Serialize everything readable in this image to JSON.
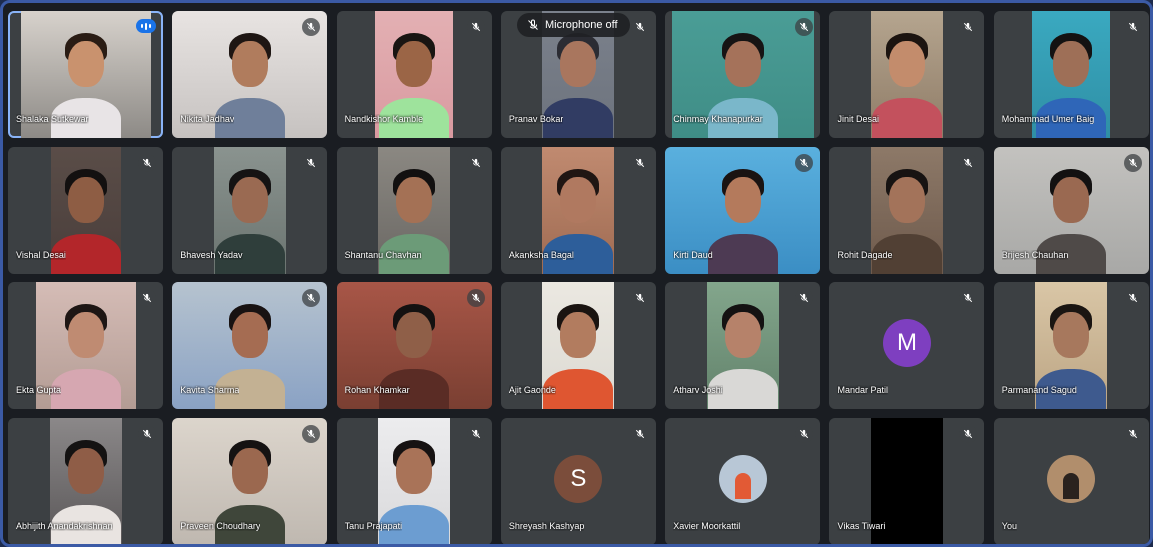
{
  "meeting": {
    "tooltip": {
      "label": "Microphone off",
      "icon": "mic-off-icon"
    },
    "accent_color": "#1a73e8",
    "participants": [
      {
        "name": "Shalaka Sutkewar",
        "status": "speaking",
        "tile": "video",
        "bg": "#8d8a86",
        "skin": "#c9926e",
        "hair": "#2a1c14",
        "shirt": "#e8e4e6",
        "video_bg": "#d7d2cc"
      },
      {
        "name": "Nikita Jadhav",
        "status": "muted",
        "tile": "video",
        "bg": "#c6c2c0",
        "skin": "#b07c5d",
        "hair": "#1e1613",
        "shirt": "#6f7f9a",
        "video_bg": "#e8e4e2"
      },
      {
        "name": "Nandkishor Kamble",
        "status": "muted",
        "tile": "video",
        "bg": "#d99aa0",
        "skin": "#9b6546",
        "hair": "#191512",
        "shirt": "#9ee39c",
        "video_bg": "#e3b0b3"
      },
      {
        "name": "Pranav Bokar",
        "status": "muted",
        "tile": "video",
        "bg": "#6d737d",
        "skin": "#a9765e",
        "hair": "#2b2c33",
        "shirt": "#313c63",
        "video_bg": "#7b818c"
      },
      {
        "name": "Chinmay Khanapurkar",
        "status": "muted",
        "tile": "video",
        "bg": "#3f8d86",
        "skin": "#a5725a",
        "hair": "#161414",
        "shirt": "#7ab7ca",
        "video_bg": "#4a9d96"
      },
      {
        "name": "Jinit Desai",
        "status": "muted",
        "tile": "video",
        "bg": "#8f7c67",
        "skin": "#c38c6c",
        "hair": "#1c1410",
        "shirt": "#c3515d",
        "video_bg": "#b5a58f"
      },
      {
        "name": "Mohammad Umer Baig",
        "status": "muted",
        "tile": "video",
        "bg": "#2f8fa5",
        "skin": "#9e6f57",
        "hair": "#141212",
        "shirt": "#2f66b8",
        "video_bg": "#3aa9c0"
      },
      {
        "name": "Vishal Desai",
        "status": "muted",
        "tile": "video",
        "bg": "#4a3e3b",
        "skin": "#8e5d44",
        "hair": "#131010",
        "shirt": "#b3262a",
        "video_bg": "#5a4d48"
      },
      {
        "name": "Bhavesh Yadav",
        "status": "muted",
        "tile": "video",
        "bg": "#6b7470",
        "skin": "#9a6a52",
        "hair": "#151313",
        "shirt": "#2f3e3b",
        "video_bg": "#8a938f"
      },
      {
        "name": "Shantanu Chavhan",
        "status": "muted",
        "tile": "video",
        "bg": "#6a6763",
        "skin": "#a47155",
        "hair": "#121010",
        "shirt": "#6c9b78",
        "video_bg": "#8b8882"
      },
      {
        "name": "Akanksha Bagal",
        "status": "muted",
        "tile": "video",
        "bg": "#9f6b52",
        "skin": "#b07960",
        "hair": "#201613",
        "shirt": "#2d5e9a",
        "video_bg": "#c08a70"
      },
      {
        "name": "Kirti Daud",
        "status": "muted",
        "tile": "video",
        "bg": "#3b8ec4",
        "skin": "#b47a5c",
        "hair": "#1a1312",
        "shirt": "#4d3a53",
        "video_bg": "#5ab0de"
      },
      {
        "name": "Rohit Dagade",
        "status": "muted",
        "tile": "video",
        "bg": "#6e5a4c",
        "skin": "#a3735a",
        "hair": "#171312",
        "shirt": "#514034",
        "video_bg": "#8d7968"
      },
      {
        "name": "Brijesh Chauhan",
        "status": "muted",
        "tile": "video",
        "bg": "#a8a8a6",
        "skin": "#9a6951",
        "hair": "#131111",
        "shirt": "#4f4a48",
        "video_bg": "#c3c2bf"
      },
      {
        "name": "Ekta Gupta",
        "status": "muted",
        "tile": "video",
        "bg": "#b39c94",
        "skin": "#bf8b72",
        "hair": "#1e1614",
        "shirt": "#d6a7b1",
        "video_bg": "#d5bcb6"
      },
      {
        "name": "Kavita Sharma",
        "status": "muted",
        "tile": "video",
        "bg": "#8aa2c4",
        "skin": "#a56c52",
        "hair": "#181212",
        "shirt": "#c3b193",
        "video_bg": "#b6c3cf"
      },
      {
        "name": "Rohan Khamkar",
        "status": "muted",
        "tile": "video",
        "bg": "#7a3f32",
        "skin": "#8f5f48",
        "hair": "#141111",
        "shirt": "#5a2c25",
        "video_bg": "#a85647"
      },
      {
        "name": "Ajit Gaonde",
        "status": "muted",
        "tile": "video",
        "bg": "#dcdad3",
        "skin": "#b27c5f",
        "hair": "#1a1411",
        "shirt": "#df5631",
        "video_bg": "#ebe8e1"
      },
      {
        "name": "Atharv Joshi",
        "status": "muted",
        "tile": "video",
        "bg": "#62826b",
        "skin": "#b6826a",
        "hair": "#141212",
        "shirt": "#d9d8d6",
        "video_bg": "#83a68c"
      },
      {
        "name": "Mandar Patil",
        "status": "muted",
        "tile": "avatar",
        "initial": "M",
        "avatar_color": "#7e3fc0"
      },
      {
        "name": "Parmanand Sagud",
        "status": "muted",
        "tile": "video",
        "bg": "#bca584",
        "skin": "#a7785d",
        "hair": "#1a1512",
        "shirt": "#3e5a8e",
        "video_bg": "#d9c6a6"
      },
      {
        "name": "Abhijith Anandakrishnan",
        "status": "muted",
        "tile": "video",
        "bg": "#5a5758",
        "skin": "#8f5d47",
        "hair": "#141212",
        "shirt": "#e9e4e1",
        "video_bg": "#8b8889"
      },
      {
        "name": "Praveen Choudhary",
        "status": "muted",
        "tile": "video",
        "bg": "#bfb8b0",
        "skin": "#9b684f",
        "hair": "#151212",
        "shirt": "#3f463a",
        "video_bg": "#dcd5cc"
      },
      {
        "name": "Tanu Prajapati",
        "status": "muted",
        "tile": "video",
        "bg": "#d9d9db",
        "skin": "#a97358",
        "hair": "#161212",
        "shirt": "#6c9dd1",
        "video_bg": "#ececee"
      },
      {
        "name": "Shreyash Kashyap",
        "status": "muted",
        "tile": "avatar",
        "initial": "S",
        "avatar_color": "#7b4d3b"
      },
      {
        "name": "Xavier Moorkattil",
        "status": "muted",
        "tile": "photo-avatar",
        "avatar_color": "#b8c7d6"
      },
      {
        "name": "Vikas Tiwari",
        "status": "muted",
        "tile": "black-video"
      },
      {
        "name": "You",
        "status": "muted",
        "tile": "photo-avatar-self",
        "avatar_color": "#b18e6c"
      }
    ]
  }
}
